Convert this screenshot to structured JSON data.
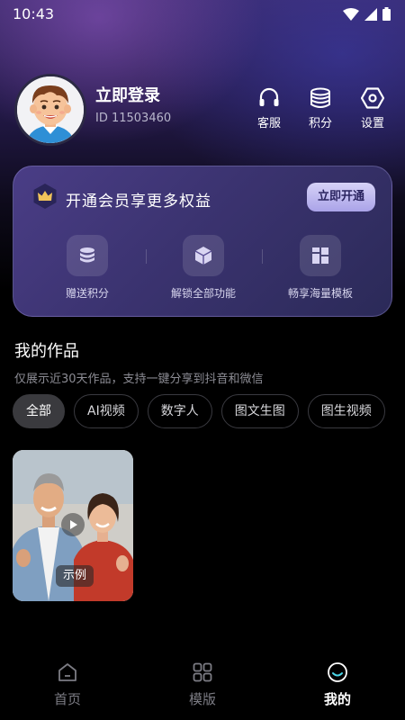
{
  "status_bar": {
    "time": "10:43"
  },
  "profile": {
    "login_label": "立即登录",
    "user_id": "ID 11503460"
  },
  "header_actions": [
    {
      "label": "客服",
      "icon": "headset-icon"
    },
    {
      "label": "积分",
      "icon": "coins-icon"
    },
    {
      "label": "设置",
      "icon": "settings-hex-icon"
    }
  ],
  "vip": {
    "title": "开通会员享更多权益",
    "button_label": "立即开通",
    "benefits": [
      {
        "label": "赠送积分",
        "icon": "coins-icon"
      },
      {
        "label": "解锁全部功能",
        "icon": "cube-icon"
      },
      {
        "label": "畅享海量模板",
        "icon": "template-grid-icon"
      }
    ]
  },
  "works": {
    "title": "我的作品",
    "subtitle": "仅展示近30天作品，支持一键分享到抖音和微信",
    "filters": [
      "全部",
      "AI视频",
      "数字人",
      "图文生图",
      "图生视频"
    ],
    "active_filter": "全部",
    "items": [
      {
        "tag": "示例"
      }
    ]
  },
  "bottom_nav": [
    {
      "label": "首页",
      "icon": "home-icon",
      "active": false
    },
    {
      "label": "模版",
      "icon": "grid-icon",
      "active": false
    },
    {
      "label": "我的",
      "icon": "profile-smile-icon",
      "active": true
    }
  ],
  "colors": {
    "accent": "#4ad6e8",
    "card": "#3b3370",
    "chip_active": "#3a3a3e"
  }
}
